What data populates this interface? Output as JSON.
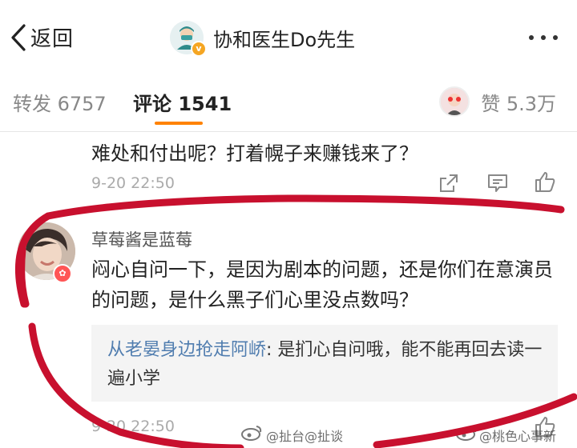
{
  "header": {
    "back_label": "返回",
    "title": "协和医生Do先生",
    "verified_badge": "v"
  },
  "tabs": {
    "repost": "转发 6757",
    "comments": "评论 1541",
    "likes": "赞 5.3万"
  },
  "previous_comment": {
    "text": "难处和付出呢？打着幌子来赚钱来了？",
    "time": "9-20 22:50"
  },
  "comment": {
    "username": "草莓酱是蓝莓",
    "text": "闷心自问一下，是因为剧本的问题，还是你们在意演员的问题，是什么黑子们心里没点数吗？",
    "reply": {
      "user": "从老晏身边抢走阿峤",
      "text": ": 是扪心自问哦，能不能再回去读一遍小学"
    },
    "time": "9-20 22:50"
  },
  "watermarks": [
    "@扯台@扯谈",
    "@桃色心事新"
  ],
  "colors": {
    "accent_orange": "#ff8200",
    "link_blue": "#507daf",
    "annotation_red": "#c8102e"
  },
  "icons": [
    "chevron-left-icon",
    "more-dots-icon",
    "share-icon",
    "comment-icon",
    "thumbs-up-icon",
    "weibo-logo-icon"
  ]
}
